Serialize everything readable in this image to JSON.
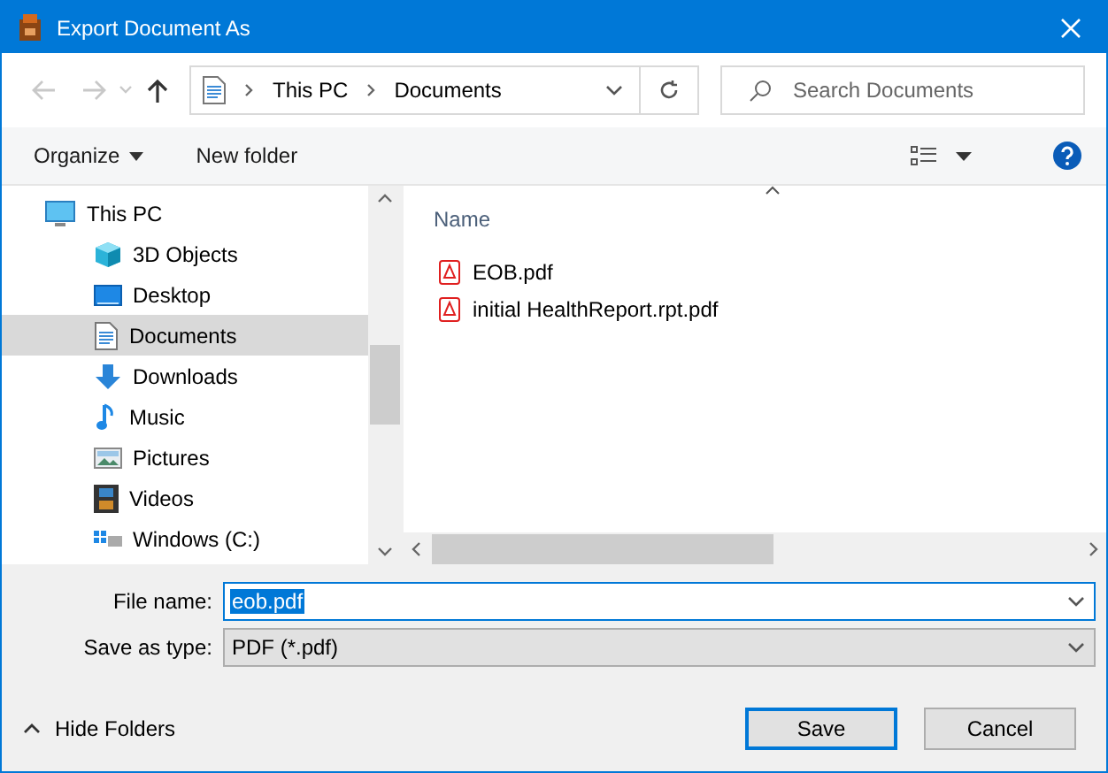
{
  "window": {
    "title": "Export Document As"
  },
  "nav": {
    "back_disabled": true,
    "forward_disabled": true,
    "crumbs": [
      "This PC",
      "Documents"
    ],
    "search": {
      "placeholder": "Search Documents"
    }
  },
  "toolbar": {
    "organize": "Organize",
    "new_folder": "New folder"
  },
  "sidebar": {
    "items": [
      {
        "label": "This PC",
        "kind": "pc",
        "selected": false,
        "children": [
          {
            "label": "3D Objects",
            "kind": "cube",
            "selected": false
          },
          {
            "label": "Desktop",
            "kind": "desktop",
            "selected": false
          },
          {
            "label": "Documents",
            "kind": "documents",
            "selected": true
          },
          {
            "label": "Downloads",
            "kind": "downloads",
            "selected": false
          },
          {
            "label": "Music",
            "kind": "music",
            "selected": false
          },
          {
            "label": "Pictures",
            "kind": "pictures",
            "selected": false
          },
          {
            "label": "Videos",
            "kind": "videos",
            "selected": false
          },
          {
            "label": "Windows (C:)",
            "kind": "drive",
            "selected": false
          }
        ]
      }
    ]
  },
  "files": {
    "column": "Name",
    "items": [
      {
        "name": "EOB.pdf",
        "kind": "pdf"
      },
      {
        "name": "initial HealthReport.rpt.pdf",
        "kind": "pdf"
      }
    ]
  },
  "form": {
    "file_name_label": "File name:",
    "file_name": "eob.pdf",
    "file_name_selected": true,
    "type_label": "Save as type:",
    "type": "PDF (*.pdf)"
  },
  "hide_folders": "Hide Folders",
  "buttons": [
    {
      "label": "Save",
      "default": true
    },
    {
      "label": "Cancel",
      "default": false
    }
  ]
}
